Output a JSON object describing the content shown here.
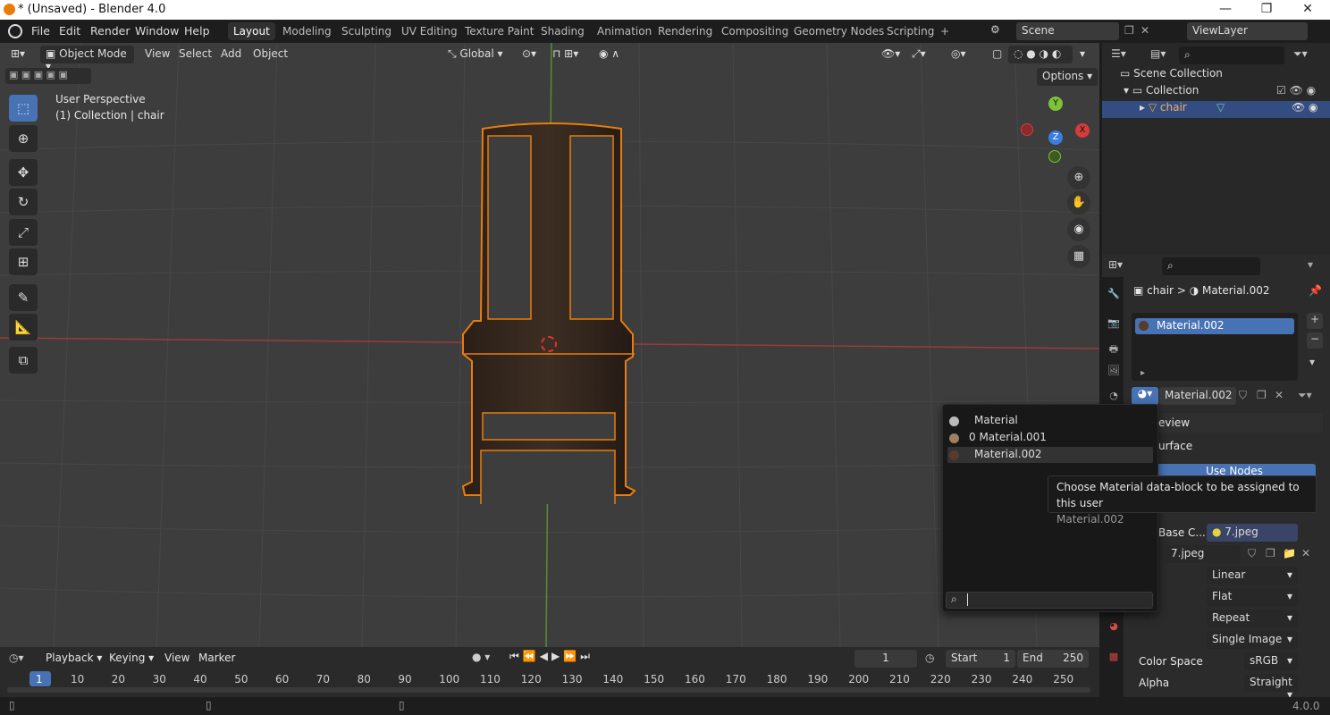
{
  "window": {
    "title": "* (Unsaved) - Blender 4.0",
    "minimize": "—",
    "maximize": "❐",
    "close": "✕"
  },
  "menu": {
    "items": [
      "File",
      "Edit",
      "Render",
      "Window",
      "Help"
    ]
  },
  "workspaces": {
    "tabs": [
      "Layout",
      "Modeling",
      "Sculpting",
      "UV Editing",
      "Texture Paint",
      "Shading",
      "Animation",
      "Rendering",
      "Compositing",
      "Geometry Nodes",
      "Scripting"
    ],
    "active": "Layout",
    "add": "+"
  },
  "scene": {
    "label": "Scene",
    "viewlayer": "ViewLayer"
  },
  "viewport": {
    "mode": "Object Mode",
    "menus": [
      "View",
      "Select",
      "Add",
      "Object"
    ],
    "transform": "Global",
    "options": "Options",
    "overlay_text_1": "User Perspective",
    "overlay_text_2": "(1) Collection | chair",
    "gizmo": {
      "x": "X",
      "y": "Y",
      "z": "Z"
    }
  },
  "outliner": {
    "scene_collection": "Scene Collection",
    "collection": "Collection",
    "object": "chair"
  },
  "properties": {
    "breadcrumb_object": "chair",
    "breadcrumb_sep": ">",
    "breadcrumb_material": "Material.002",
    "slot": "Material.002",
    "material_name": "Material.002",
    "panel_preview": "eview",
    "panel_surface": "urface",
    "use_nodes": "Use Nodes",
    "base_color_label": "Base C...",
    "base_color_value": "7.jpeg",
    "image_name": "7.jpeg",
    "interp": "Linear",
    "projection": "Flat",
    "extension": "Repeat",
    "source": "Single Image",
    "color_space_label": "Color Space",
    "color_space": "sRGB",
    "alpha_label": "Alpha",
    "alpha": "Straight"
  },
  "popup": {
    "items": [
      "Material",
      "0 Material.001",
      "Material.002"
    ],
    "highlighted": "Material.002",
    "search_placeholder": ""
  },
  "tooltip": {
    "line1": "Choose Material data-block to be assigned to this user",
    "line2": "Material.002"
  },
  "timeline": {
    "menus": [
      "Playback",
      "Keying",
      "View",
      "Marker"
    ],
    "current_frame": "1",
    "start_label": "Start",
    "start": "1",
    "end_label": "End",
    "end": "250",
    "ticks": [
      "1",
      "10",
      "20",
      "30",
      "40",
      "50",
      "60",
      "70",
      "80",
      "90",
      "100",
      "110",
      "120",
      "130",
      "140",
      "150",
      "160",
      "170",
      "180",
      "190",
      "200",
      "210",
      "220",
      "230",
      "240",
      "250"
    ]
  },
  "status": {
    "version": "4.0.0"
  },
  "colors": {
    "accent": "#4772b3",
    "selection": "#e87d0d",
    "x_axis": "#d63b3b",
    "y_axis": "#7ec23a",
    "z_axis": "#3a7de0"
  }
}
